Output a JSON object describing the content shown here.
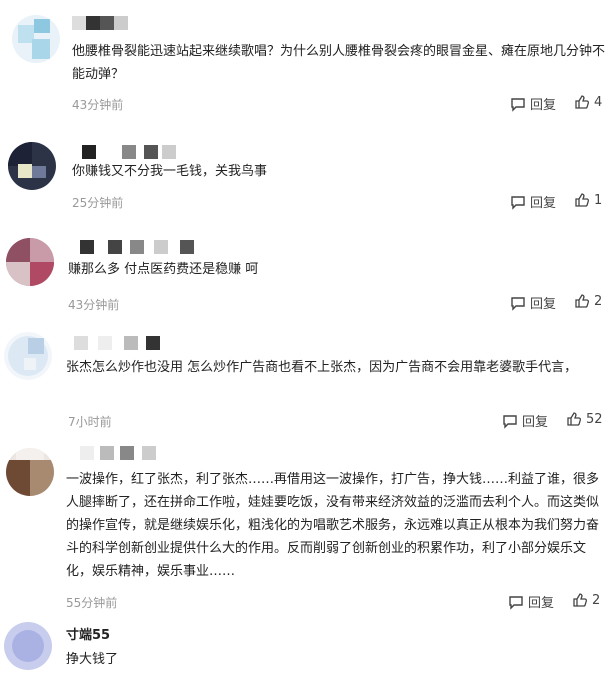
{
  "comments": [
    {
      "user": "",
      "text": "他腰椎骨裂能迅速站起来继续歌唱？为什么别人腰椎骨裂会疼的眼冒金星、瘫在原地几分钟不能动弹？",
      "time": "43分钟前",
      "reply_label": "回复",
      "likes": "4"
    },
    {
      "user": "",
      "text": "你赚钱又不分我一毛钱，关我鸟事",
      "time": "25分钟前",
      "reply_label": "回复",
      "likes": "1"
    },
    {
      "user": "",
      "text": "赚那么多 付点医药费还是稳赚 呵",
      "time": "43分钟前",
      "reply_label": "回复",
      "likes": "2"
    },
    {
      "user": "",
      "text": "张杰怎么炒作也没用 怎么炒作广告商也看不上张杰，因为广告商不会用靠老婆歌手代言，",
      "time": "7小时前",
      "reply_label": "回复",
      "likes": "52"
    },
    {
      "user": "",
      "text": "一波操作，红了张杰，利了张杰……再借用这一波操作，打广告，挣大钱……利益了谁，很多人腿摔断了，还在拼命工作啦，娃娃要吃饭，没有带来经济效益的泛滥而去利个人。而这类似的操作宣传，就是继续娱乐化，粗浅化的为唱歌艺术服务，永远难以真正从根本为我们努力奋斗的科学创新创业提供什么大的作用。反而削弱了创新创业的积累作功，利了小部分娱乐文化，娱乐精神，娱乐事业……",
      "time": "55分钟前",
      "reply_label": "回复",
      "likes": "2"
    },
    {
      "user": "寸端55",
      "text": "挣大钱了",
      "time": "",
      "reply_label": "",
      "likes": ""
    }
  ],
  "colors": {
    "accent_text": "#222222",
    "meta": "#999999"
  }
}
